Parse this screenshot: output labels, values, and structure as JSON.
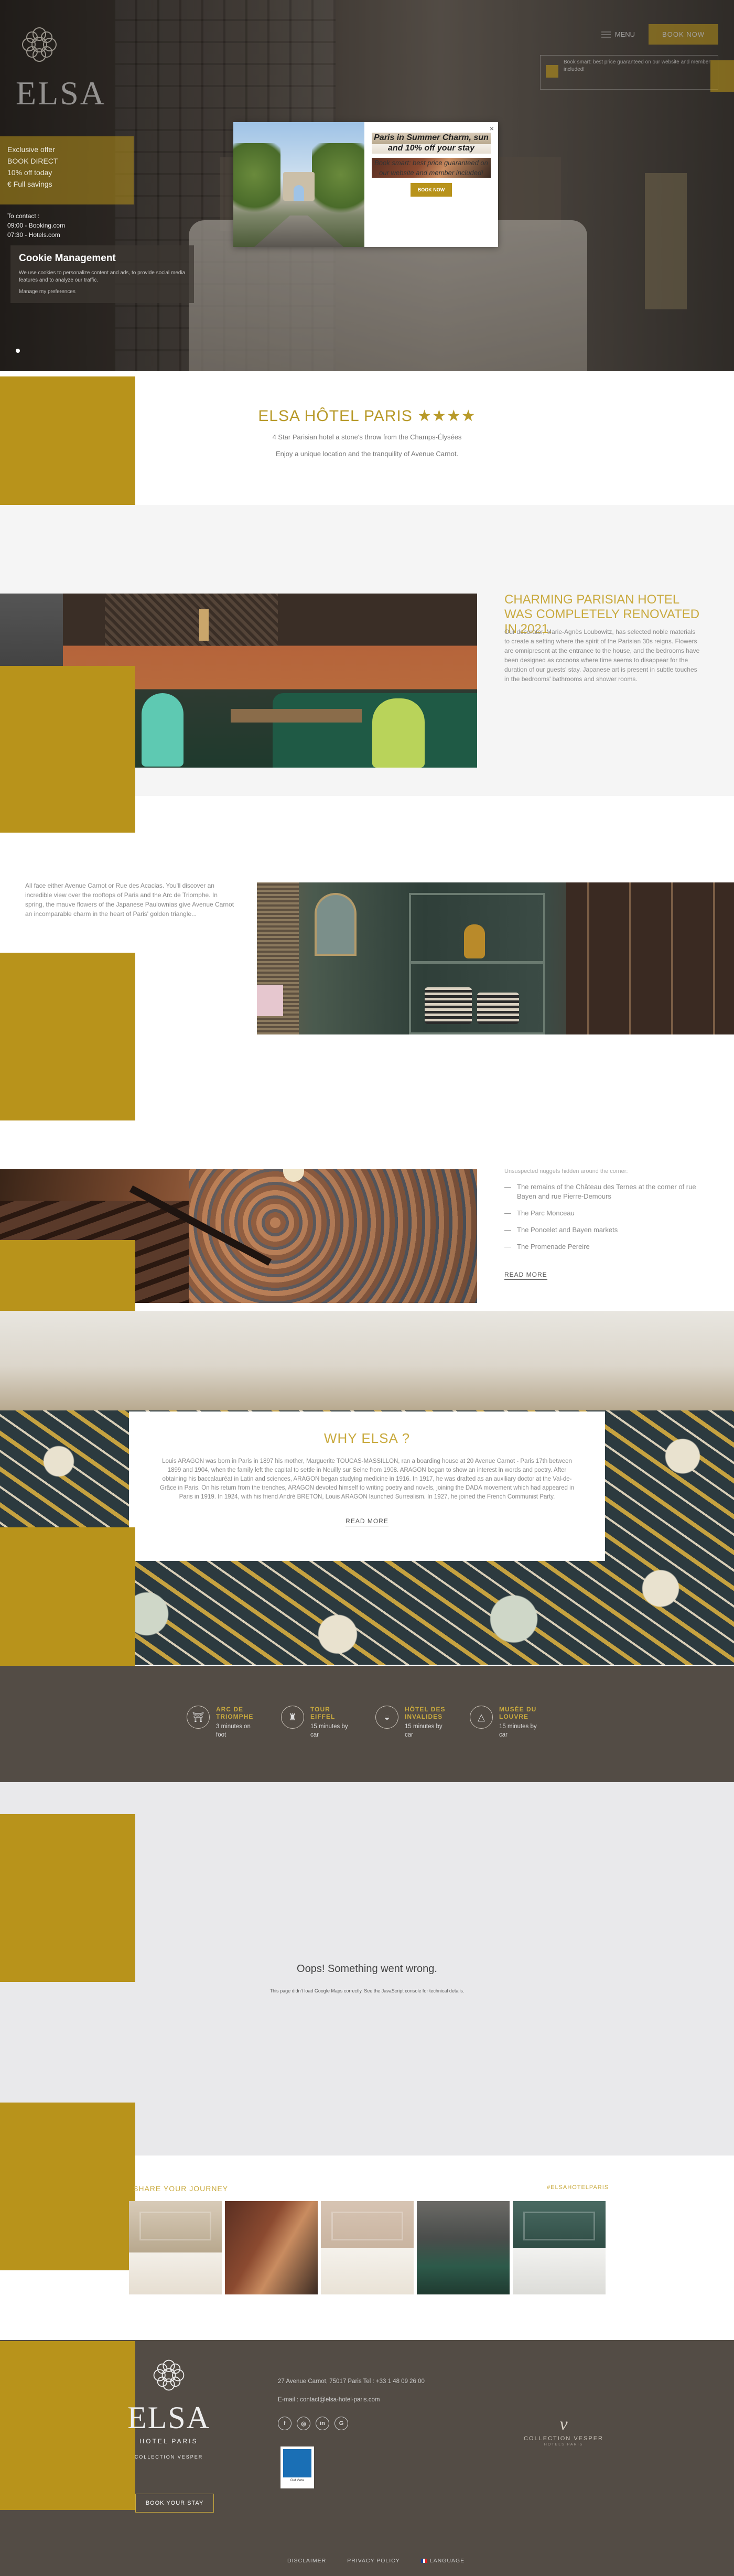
{
  "hero": {
    "logo_text": "ELSA",
    "menu_label": "MENU",
    "book_label": "BOOK NOW",
    "side_panel": [
      "Exclusive offer",
      "BOOK DIRECT",
      "10% off today",
      "€ Full savings"
    ],
    "contact_title": "To contact :",
    "contact_lines": [
      "09:00 - Booking.com",
      "07:30 - Hotels.com"
    ],
    "promo_note": "Book smart: best price guaranteed on our website and member included!"
  },
  "cookie": {
    "title": "Cookie Management",
    "text": "We use cookies to personalize content and ads, to provide social media features and to analyze our traffic.",
    "manage": "Manage my preferences"
  },
  "popup": {
    "title": "Paris in Summer Charm, sun and 10% off your stay",
    "body": "Book smart: best price guaranteed on our website and member included!",
    "button": "BOOK NOW",
    "close": "×"
  },
  "intro": {
    "title": "ELSA HÔTEL PARIS",
    "stars": "★★★★",
    "line1": "4 Star Parisian hotel a stone's throw from the Champs-Élysées",
    "line2": "Enjoy a unique location and the tranquility of Avenue Carnot."
  },
  "section1": {
    "title": "CHARMING PARISIAN HOTEL WAS COMPLETELY RENOVATED IN 2021.",
    "body": "Our decorator, Marie-Agnès Loubowitz, has selected noble materials to create a setting where the spirit of the Parisian 30s reigns. Flowers are omnipresent at the entrance to the house, and the bedrooms have been designed as cocoons where time seems to disappear for the duration of our guests' stay. Japanese art is present in subtle touches in the bedrooms' bathrooms and shower rooms."
  },
  "section2": {
    "body": "All face either Avenue Carnot or Rue des Acacias. You'll discover an incredible view over the rooftops of Paris and the Arc de Triomphe. In spring, the mauve flowers of the Japanese Paulownias give Avenue Carnot an incomparable charm in the heart of Paris' golden triangle..."
  },
  "section3": {
    "intro": "Unsuspected nuggets hidden around the corner:",
    "items": [
      "The remains of the Château des Ternes at the corner of rue Bayen and rue Pierre-Demours",
      "The Parc Monceau",
      "The Poncelet and Bayen markets",
      "The Promenade Pereire"
    ],
    "read_more": "READ MORE"
  },
  "why": {
    "title": "WHY ELSA ?",
    "body": "Louis ARAGON was born in Paris in 1897 his mother, Marguerite TOUCAS-MASSILLON, ran a boarding house at 20 Avenue Carnot - Paris 17th between 1899 and 1904, when the family left the capital to settle in Neuilly sur Seine from 1908. ARAGON began to show an interest in words and poetry. After obtaining his baccalauréat in Latin and sciences, ARAGON began studying medicine in 1916. In 1917, he was drafted as an auxiliary doctor at the Val-de-Grâce in Paris. On his return from the trenches, ARAGON devoted himself to writing poetry and novels, joining the DADA movement which had appeared in Paris in 1919. In 1924, with his friend André BRETON, Louis ARAGON launched Surrealism. In 1927, he joined the French Communist Party.",
    "read_more": "READ MORE"
  },
  "distances": [
    {
      "label": "ARC DE TRIOMPHE",
      "value": "3 minutes on foot",
      "icon": "arch-icon",
      "glyph": "⛩"
    },
    {
      "label": "TOUR EIFFEL",
      "value": "15 minutes by car",
      "icon": "eiffel-icon",
      "glyph": "♜"
    },
    {
      "label": "HÔTEL DES INVALIDES",
      "value": "15 minutes by car",
      "icon": "dome-icon",
      "glyph": "◒"
    },
    {
      "label": "MUSÉE DU LOUVRE",
      "value": "15 minutes by car",
      "icon": "pyramid-icon",
      "glyph": "△"
    }
  ],
  "map": {
    "title": "Oops! Something went wrong.",
    "subtitle": "This page didn't load Google Maps correctly. See the JavaScript console for technical details."
  },
  "journey": {
    "title": "SHARE YOUR JOURNEY",
    "tag": "#ELSAHOTELPARIS"
  },
  "footer": {
    "logo_text": "ELSA",
    "hotel_label": "HOTEL PARIS",
    "collection": "COLLECTION VESPER",
    "book_stay": "BOOK YOUR STAY",
    "address": "27 Avenue Carnot, 75017 Paris    Tel : +33 1 48 09 26 00",
    "email": "E-mail : contact@elsa-hotel-paris.com",
    "socials": [
      "f",
      "◎",
      "in",
      "G"
    ],
    "badge_label": "Clef Verte",
    "vesper_sig": "ν",
    "vesper_name": "COLLECTION VESPER",
    "vesper_tag": "HOTELS PARIS",
    "links": [
      "DISCLAIMER",
      "PRIVACY POLICY",
      "LANGUAGE"
    ]
  },
  "colors": {
    "gold": "#b8931b",
    "dark": "#534c45",
    "light_gold_text": "#c9aa3e"
  }
}
